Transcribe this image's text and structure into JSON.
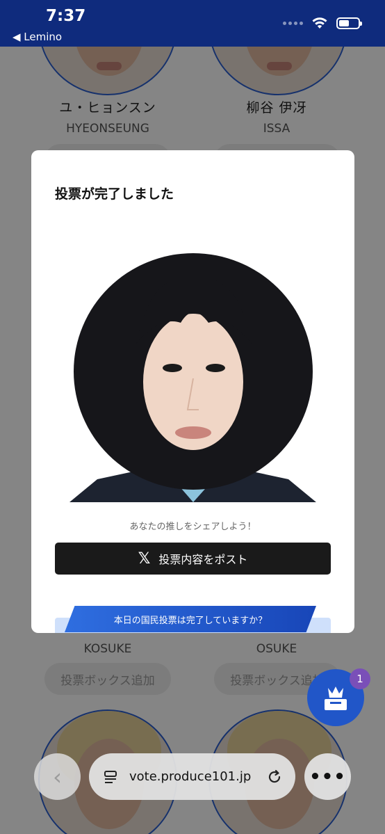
{
  "status": {
    "time": "7:37",
    "back_app": "◀ Lemino"
  },
  "background": {
    "trainees_top": [
      {
        "name_jp": "ユ・ヒョンスン",
        "name_en": "HYEONSEUNG"
      },
      {
        "name_jp": "柳谷 伊冴",
        "name_en": "ISSA"
      }
    ],
    "trainees_bottom": [
      {
        "name_en": "KOSUKE",
        "add_label": "投票ボックス追加"
      },
      {
        "name_en": "OSUKE",
        "add_label": "投票ボックス追加"
      }
    ]
  },
  "modal": {
    "title": "投票が完了しました",
    "share_prompt": "あなたの推しをシェアしよう！",
    "post_button_label": "投票内容をポスト",
    "banner_text": "本日の国民投票は完了していますか？"
  },
  "vote_box": {
    "badge_count": "1"
  },
  "browser": {
    "url": "vote.produce101.jp"
  },
  "colors": {
    "status_bar": "#0f2b7d",
    "accent_blue": "#2156c8",
    "post_button": "#1a1a1a"
  }
}
